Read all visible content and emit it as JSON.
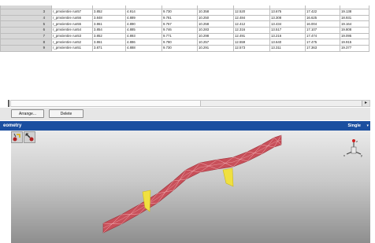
{
  "table": {
    "rows": [
      {
        "index": "3",
        "label": "r_pms/entire run57",
        "values": [
          "3.852",
          "4.914",
          "9.730",
          "10.358",
          "12.520",
          "13.675",
          "17.422",
          "19.138"
        ]
      },
      {
        "index": "4",
        "label": "r_pms/entire run56",
        "values": [
          "3.848",
          "4.889",
          "9.781",
          "10.250",
          "12.484",
          "13.308",
          "16.625",
          "18.931"
        ]
      },
      {
        "index": "5",
        "label": "r_pms/entire run55",
        "values": [
          "3.861",
          "4.890",
          "9.767",
          "10.258",
          "12.412",
          "13.434",
          "16.004",
          "19.164"
        ]
      },
      {
        "index": "6",
        "label": "r_pms/entire run54",
        "values": [
          "3.854",
          "4.885",
          "9.746",
          "10.283",
          "12.316",
          "13.517",
          "17.107",
          "19.808"
        ]
      },
      {
        "index": "7",
        "label": "r_pms/entire run53",
        "values": [
          "3.852",
          "4.893",
          "9.771",
          "10.298",
          "12.491",
          "13.216",
          "17.474",
          "19.095"
        ]
      },
      {
        "index": "8",
        "label": "r_pms/entire run52",
        "values": [
          "3.861",
          "4.886",
          "9.780",
          "10.257",
          "12.559",
          "13.640",
          "17.475",
          "19.915"
        ]
      },
      {
        "index": "9",
        "label": "r_pms/entire run51",
        "values": [
          "3.871",
          "4.888",
          "9.730",
          "10.291",
          "12.573",
          "13.311",
          "17.363",
          "19.377"
        ]
      }
    ],
    "scroll_right_glyph": "▸"
  },
  "buttons": {
    "arrange": "Arrange...",
    "delete": "Delete"
  },
  "geometry": {
    "title": "eometry",
    "mode": "Single",
    "mode_arrow": "▾",
    "axis_labels": {
      "x": "x",
      "y": "y",
      "z": "z"
    }
  },
  "colors": {
    "header_blue": "#1b4fa0",
    "mesh_fill": "#c8505a",
    "mesh_line": "#f0b0b4",
    "support": "#f0e040"
  },
  "icons": [
    "select-tool-icon",
    "pan-tool-icon"
  ]
}
